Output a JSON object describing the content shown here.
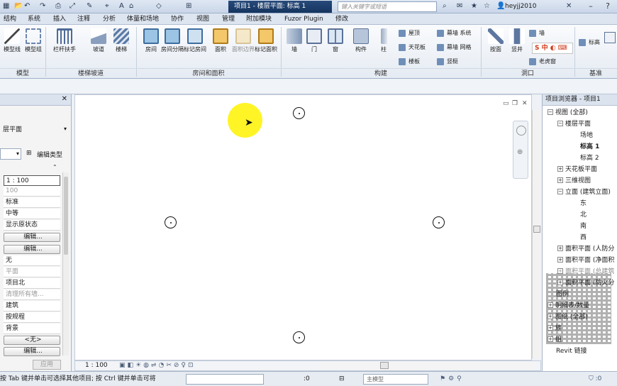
{
  "title_bar": {
    "document_title": "项目1 - 楼层平面: 标高 1",
    "search_placeholder": "键入关键字或短语",
    "user": "heyjj2010"
  },
  "ribbon_tabs": [
    "结构",
    "系统",
    "插入",
    "注释",
    "分析",
    "体量和场地",
    "协作",
    "视图",
    "管理",
    "附加模块",
    "Fuzor Plugin",
    "修改"
  ],
  "ribbon": {
    "left_buttons": [
      "模型线",
      "模型组"
    ],
    "stairs": [
      "栏杆扶手",
      "坡道",
      "楼梯"
    ],
    "rooms": [
      "房间",
      "房间分隔",
      "标记房间",
      "面积",
      "面积边界",
      "标记面积"
    ],
    "build_big": [
      "墙",
      "门",
      "窗",
      "构件",
      "柱"
    ],
    "build_small": [
      "屋顶",
      "天花板",
      "楼板",
      "幕墙 系统",
      "幕墙 网格",
      "竖梃"
    ],
    "opening": [
      "按面",
      "竖井",
      "墙",
      "老虎窗"
    ],
    "datum_label": "标高",
    "panel_labels": [
      "模型",
      "楼梯坡道",
      "房间和面积",
      "构建",
      "洞口",
      "基准"
    ]
  },
  "properties": {
    "type_label": "层平面",
    "edit_type": "编辑类型",
    "rows": [
      "1 : 100",
      "100",
      "标准",
      "中等",
      "显示原状态",
      "编辑...",
      "编辑...",
      "无",
      "平面",
      "项目北",
      "清理所有墙...",
      "建筑",
      "按规程",
      "背景",
      "<无>",
      "编辑..."
    ],
    "apply": "应用"
  },
  "canvas": {
    "scale": "1 : 100",
    "window_controls": [
      "▭",
      "❐",
      "✕"
    ]
  },
  "browser": {
    "title": "项目浏览器 - 项目1",
    "items": [
      {
        "label": "视图 (全部)",
        "level": 0,
        "exp": "−"
      },
      {
        "label": "楼层平面",
        "level": 1,
        "exp": "−"
      },
      {
        "label": "场地",
        "level": 2,
        "exp": ""
      },
      {
        "label": "标高 1",
        "level": 2,
        "exp": "",
        "bold": true
      },
      {
        "label": "标高 2",
        "level": 2,
        "exp": ""
      },
      {
        "label": "天花板平面",
        "level": 1,
        "exp": "+"
      },
      {
        "label": "三维视图",
        "level": 1,
        "exp": "+"
      },
      {
        "label": "立面 (建筑立面)",
        "level": 1,
        "exp": "−"
      },
      {
        "label": "东",
        "level": 2,
        "exp": ""
      },
      {
        "label": "北",
        "level": 2,
        "exp": ""
      },
      {
        "label": "南",
        "level": 2,
        "exp": ""
      },
      {
        "label": "西",
        "level": 2,
        "exp": ""
      },
      {
        "label": "面积平面 (人防分",
        "level": 1,
        "exp": "+"
      },
      {
        "label": "面积平面 (净面积",
        "level": 1,
        "exp": "+"
      },
      {
        "label": "面积平面 (总建筑",
        "level": 1,
        "exp": "+",
        "gray": true
      },
      {
        "label": "面积平面 (防火分",
        "level": 1,
        "exp": "+"
      },
      {
        "label": "图例",
        "level": 0,
        "exp": ""
      },
      {
        "label": "明细表/数量",
        "level": 0,
        "exp": "+"
      },
      {
        "label": "图纸 (全部)",
        "level": 0,
        "exp": "+"
      },
      {
        "label": "族",
        "level": 0,
        "exp": "+"
      },
      {
        "label": "组",
        "level": 0,
        "exp": "+"
      },
      {
        "label": "Revit 链接",
        "level": 0,
        "exp": ""
      }
    ]
  },
  "status": {
    "hint": "按 Tab 键并单击可选择其他项目; 按 Ctrl 键并单击可将",
    "count": ":0",
    "model": "主模型"
  },
  "colors": {
    "title_active": "#1e3f6c",
    "highlight": "#fff200"
  }
}
